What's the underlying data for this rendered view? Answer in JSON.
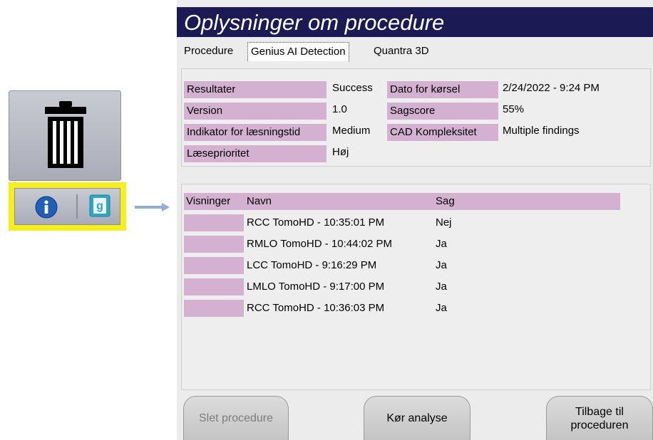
{
  "dialog": {
    "title": "Oplysninger om procedure",
    "tabs": [
      {
        "label": "Procedure"
      },
      {
        "label": "Genius AI Detection"
      },
      {
        "label": "Quantra 3D"
      }
    ],
    "active_tab": "Genius AI Detection"
  },
  "info": {
    "rows": [
      {
        "label": "Resultater",
        "value": "Success"
      },
      {
        "label": "Version",
        "value": "1.0"
      },
      {
        "label": "Indikator for læsningstid",
        "value": "Medium"
      },
      {
        "label": "Læseprioritet",
        "value": "Høj"
      }
    ],
    "rows_right": [
      {
        "label": "Dato for kørsel",
        "value": "2/24/2022 - 9:24 PM"
      },
      {
        "label": "Sagscore",
        "value": "55%"
      },
      {
        "label": "CAD Kompleksitet",
        "value": "Multiple findings"
      }
    ]
  },
  "views": {
    "headers": {
      "views": "Visninger",
      "name": "Navn",
      "case": "Sag"
    },
    "rows": [
      {
        "name": "RCC TomoHD - 10:35:01 PM",
        "case": "Nej"
      },
      {
        "name": "RMLO TomoHD - 10:44:02 PM",
        "case": "Ja"
      },
      {
        "name": "LCC TomoHD - 9:16:29 PM",
        "case": "Ja"
      },
      {
        "name": "LMLO TomoHD - 9:17:00 PM",
        "case": "Ja"
      },
      {
        "name": "RCC TomoHD - 10:36:03 PM",
        "case": "Ja"
      }
    ]
  },
  "buttons": {
    "delete": "Slet procedure",
    "run": "Kør analyse",
    "back": "Tilbage til proceduren"
  },
  "icons": {
    "trash": "trash-icon",
    "info": "info-icon",
    "genius": "genius-g-icon",
    "arrow": "arrow-right-icon"
  },
  "colors": {
    "title_bar": "#1b1a55",
    "label_bg": "#d4b1d1",
    "highlight": "#f5ef1c",
    "info_icon": "#1f5fb8",
    "genius_icon": "#2ea6c8"
  }
}
